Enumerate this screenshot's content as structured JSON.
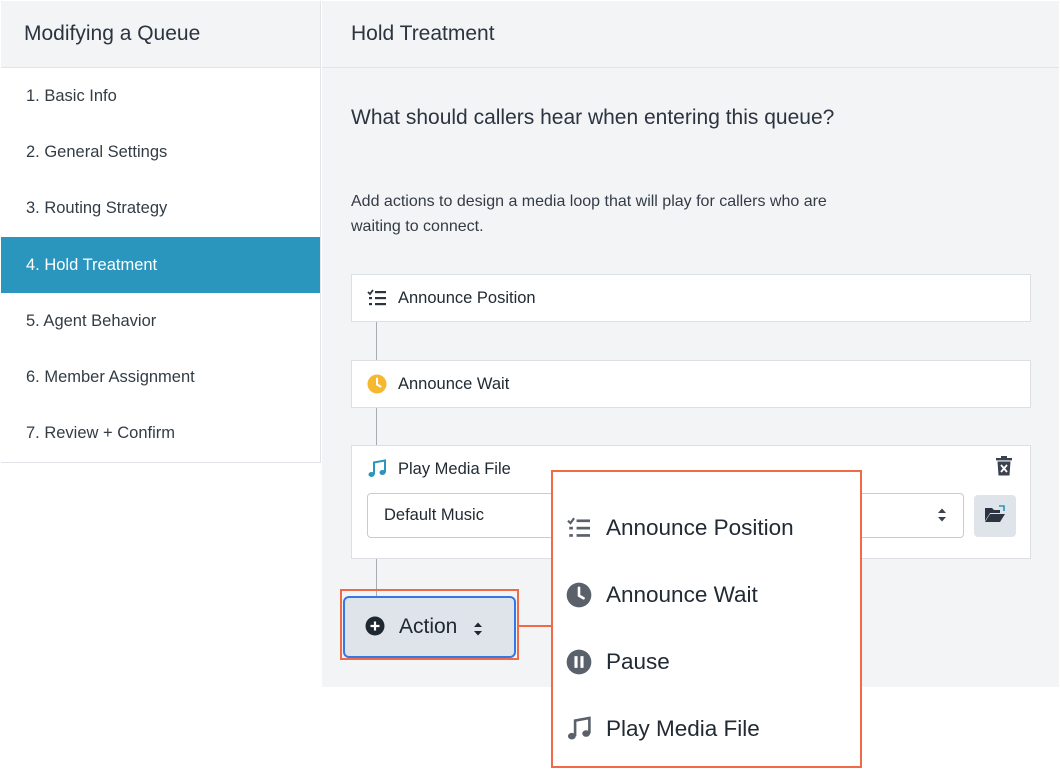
{
  "sidebar": {
    "title": "Modifying a Queue",
    "items": [
      {
        "label": "1. Basic Info"
      },
      {
        "label": "2. General Settings"
      },
      {
        "label": "3. Routing Strategy"
      },
      {
        "label": "4. Hold Treatment",
        "active": true
      },
      {
        "label": "5. Agent Behavior"
      },
      {
        "label": "6. Member Assignment"
      },
      {
        "label": "7. Review + Confirm"
      }
    ]
  },
  "main": {
    "title": "Hold Treatment",
    "question": "What should callers hear when entering this queue?",
    "description": "Add actions to design a media loop that will play for callers who are waiting to connect.",
    "steps": [
      {
        "label": "Announce Position",
        "icon": "checklist-icon"
      },
      {
        "label": "Announce Wait",
        "icon": "clock-icon"
      },
      {
        "label": "Play Media File",
        "icon": "music-note-icon",
        "select_value": "Default Music"
      }
    ],
    "action_button": "Action"
  },
  "action_menu": {
    "items": [
      {
        "label": "Announce Position",
        "icon": "checklist-icon"
      },
      {
        "label": "Announce Wait",
        "icon": "clock-icon"
      },
      {
        "label": "Pause",
        "icon": "pause-icon"
      },
      {
        "label": "Play Media File",
        "icon": "music-note-icon"
      }
    ]
  },
  "colors": {
    "accent": "#2a95bd",
    "highlight": "#f06a47",
    "focus": "#3578e5",
    "clock": "#f5b82e"
  }
}
